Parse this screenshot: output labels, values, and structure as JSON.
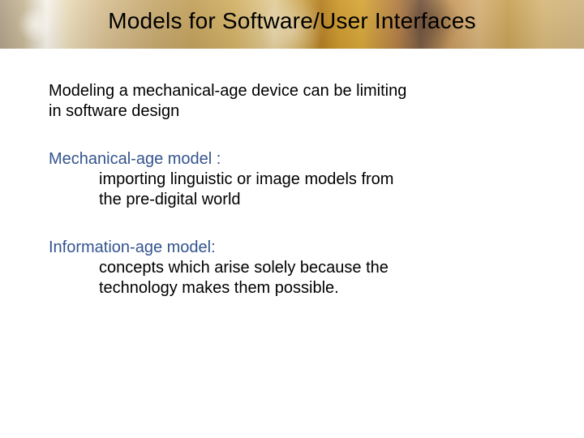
{
  "title": "Models for Software/User Interfaces",
  "intro_l1": "Modeling a mechanical-age device can be limiting",
  "intro_l2": "in software design",
  "sec1": {
    "heading": "Mechanical-age model :",
    "l1": "importing linguistic or image models from",
    "l2": "the pre-digital world"
  },
  "sec2": {
    "heading": "Information-age model:",
    "l1": "concepts which arise solely because the",
    "l2": "technology makes them possible."
  }
}
